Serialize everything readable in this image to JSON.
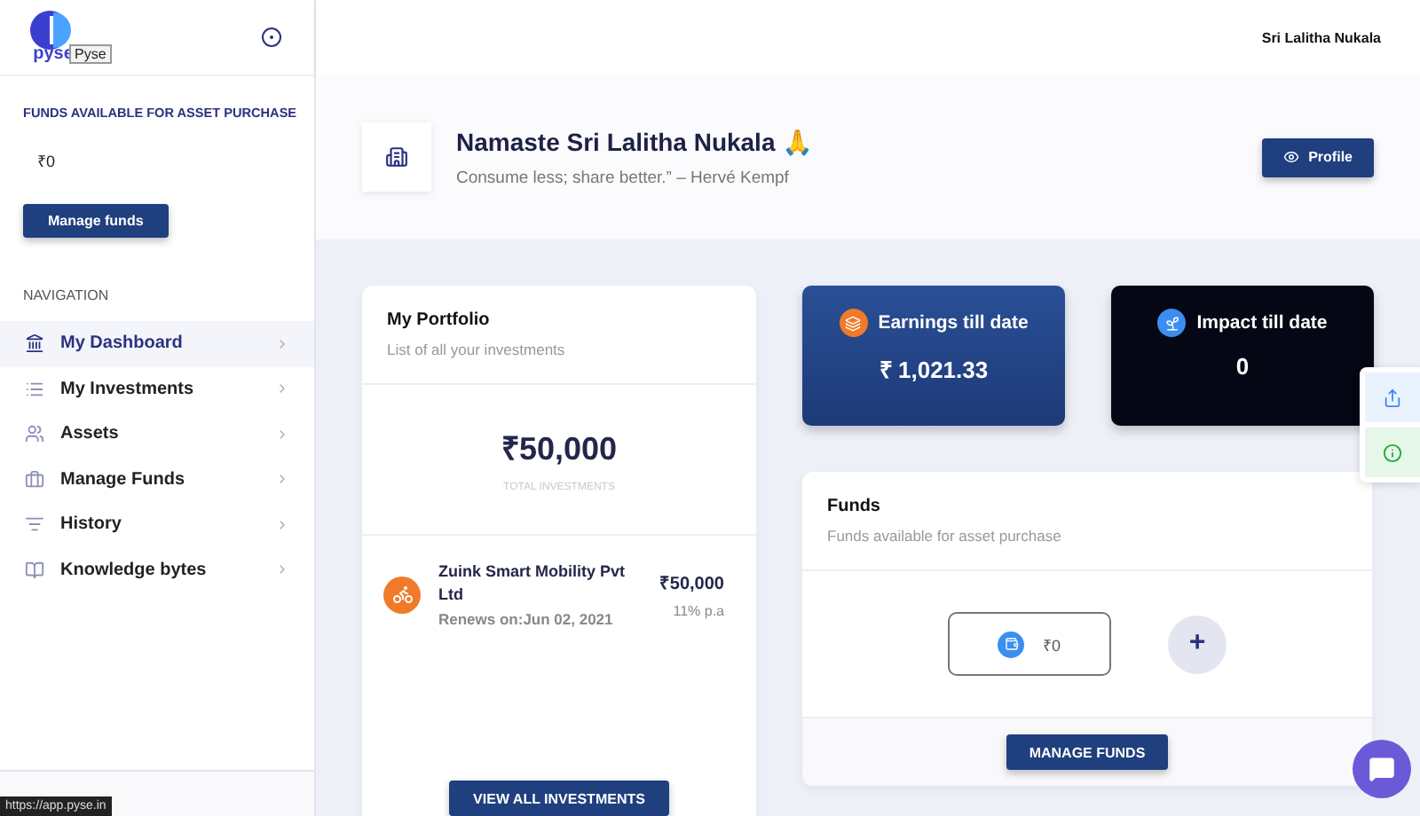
{
  "sidebar": {
    "logo_text": "pyse",
    "logo_tooltip": "Pyse",
    "funds_label": "FUNDS AVAILABLE FOR ASSET PURCHASE",
    "funds_value": "₹0",
    "manage_button": "Manage funds",
    "nav_heading": "NAVIGATION",
    "items": [
      {
        "label": "My Dashboard",
        "selected": true
      },
      {
        "label": "My Investments",
        "selected": false
      },
      {
        "label": "Assets",
        "selected": false
      },
      {
        "label": "Manage Funds",
        "selected": false
      },
      {
        "label": "History",
        "selected": false
      },
      {
        "label": "Knowledge bytes",
        "selected": false
      }
    ]
  },
  "topbar": {
    "user": "Sri Lalitha Nukala"
  },
  "header": {
    "greeting": "Namaste Sri Lalitha Nukala 🙏",
    "quote": "Consume less; share better.” – Hervé Kempf",
    "profile_button": "Profile"
  },
  "portfolio": {
    "title": "My Portfolio",
    "subtitle": "List of all your investments",
    "total": "₹50,000",
    "total_label": "TOTAL INVESTMENTS",
    "investments": [
      {
        "name": "Zuink Smart Mobility Pvt Ltd",
        "renews": "Renews on:Jun 02, 2021",
        "amount": "₹50,000",
        "rate": "11% p.a"
      }
    ],
    "view_all_button": "VIEW ALL INVESTMENTS"
  },
  "stats": [
    {
      "title": "Earnings till date",
      "value": "₹ 1,021.33",
      "kind": "earnings"
    },
    {
      "title": "Impact till date",
      "value": "0",
      "kind": "impact"
    }
  ],
  "funds": {
    "title": "Funds",
    "subtitle": "Funds available for asset purchase",
    "wallet": "₹0",
    "add_button": "+",
    "manage_button": "MANAGE FUNDS"
  },
  "status_url": "https://app.pyse.in"
}
